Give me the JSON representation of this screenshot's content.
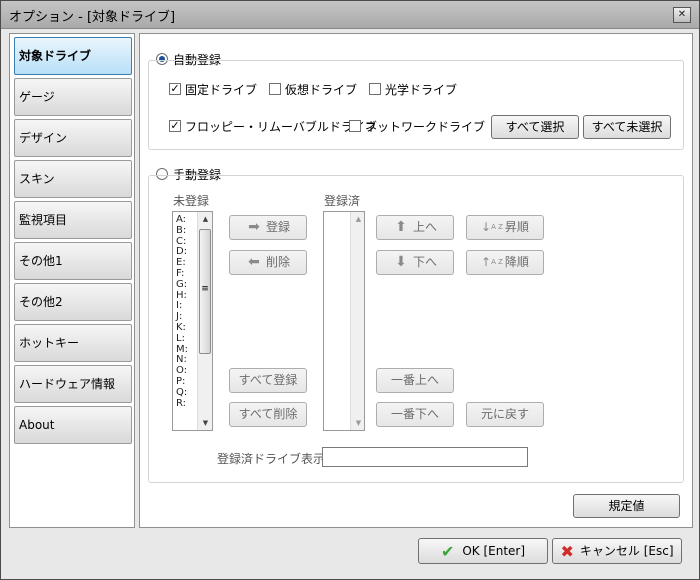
{
  "window": {
    "title": "オプション - [対象ドライブ]",
    "close_glyph": "✕"
  },
  "sidebar": {
    "items": [
      {
        "label": "対象ドライブ",
        "active": true
      },
      {
        "label": "ゲージ"
      },
      {
        "label": "デザイン"
      },
      {
        "label": "スキン"
      },
      {
        "label": "監視項目"
      },
      {
        "label": "その他1"
      },
      {
        "label": "その他2"
      },
      {
        "label": "ホットキー"
      },
      {
        "label": "ハードウェア情報"
      },
      {
        "label": "About"
      }
    ]
  },
  "auto": {
    "label": "自動登録",
    "selected": true,
    "checkboxes": {
      "fixed": {
        "label": "固定ドライブ",
        "checked": true
      },
      "virtual": {
        "label": "仮想ドライブ",
        "checked": false
      },
      "optical": {
        "label": "光学ドライブ",
        "checked": false
      },
      "removable": {
        "label": "フロッピー・リムーバブルドライブ",
        "checked": true
      },
      "network": {
        "label": "ネットワークドライブ",
        "checked": false
      }
    },
    "select_all": "すべて選択",
    "deselect_all": "すべて未選択"
  },
  "manual": {
    "label": "手動登録",
    "selected": false,
    "unregistered_label": "未登録",
    "registered_label": "登録済",
    "drives": [
      "A:",
      "B:",
      "C:",
      "D:",
      "E:",
      "F:",
      "G:",
      "H:",
      "I:",
      "J:",
      "K:",
      "L:",
      "M:",
      "N:",
      "O:",
      "P:",
      "Q:",
      "R:"
    ],
    "register_btn": "登録",
    "remove_btn": "削除",
    "register_all_btn": "すべて登録",
    "remove_all_btn": "すべて削除",
    "up_btn": "上へ",
    "down_btn": "下へ",
    "asc_btn": "昇順",
    "desc_btn": "降順",
    "top_btn": "一番上へ",
    "bottom_btn": "一番下へ",
    "reset_btn": "元に戻す",
    "display_label": "登録済ドライブ表示",
    "display_value": ""
  },
  "footer": {
    "defaults_btn": "規定値",
    "ok_btn": "OK [Enter]",
    "cancel_btn": "キャンセル [Esc]"
  }
}
